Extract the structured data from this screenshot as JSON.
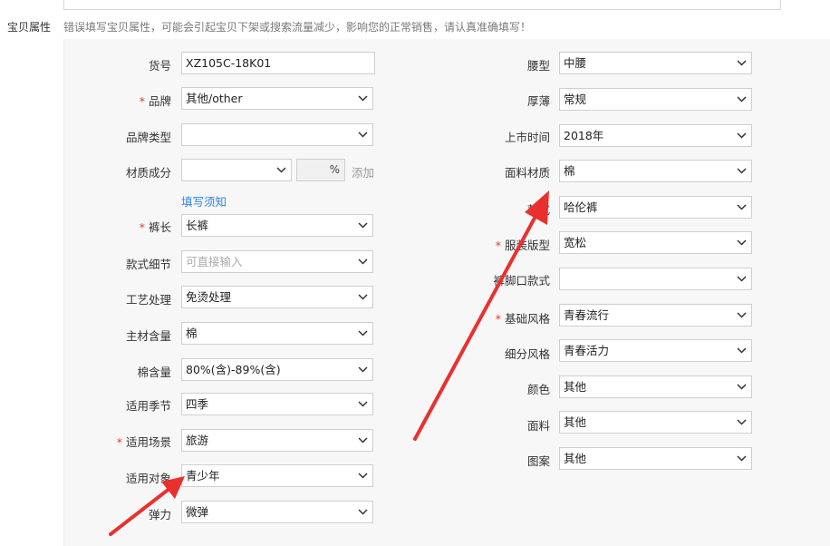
{
  "section": {
    "label": "宝贝属性",
    "note": "错误填写宝贝属性，可能会引起宝贝下架或搜索流量减少，影响您的正常销售，请认真准确填写！"
  },
  "left_fields": [
    {
      "label": "货号",
      "value": "XZ105C-18K01",
      "required": false
    },
    {
      "label": "品牌",
      "value": "其他/other",
      "required": true
    },
    {
      "label": "品牌类型",
      "value": "",
      "required": false
    },
    {
      "label": "材质成分",
      "value": "",
      "required": false
    },
    {
      "label": "裤长",
      "value": "长裤",
      "required": true
    },
    {
      "label": "款式细节",
      "value": "",
      "placeholder": "可直接输入",
      "required": false
    },
    {
      "label": "工艺处理",
      "value": "免烫处理",
      "required": false
    },
    {
      "label": "主材含量",
      "value": "棉",
      "required": false
    },
    {
      "label": "棉含量",
      "value": "80%(含)-89%(含)",
      "required": false
    },
    {
      "label": "适用季节",
      "value": "四季",
      "required": false
    },
    {
      "label": "适用场景",
      "value": "旅游",
      "required": true
    },
    {
      "label": "适用对象",
      "value": "青少年",
      "required": false
    },
    {
      "label": "弹力",
      "value": "微弹",
      "required": false
    }
  ],
  "material": {
    "percent_suffix": "%",
    "add_label": "添加",
    "help_link": "填写须知"
  },
  "right_fields": [
    {
      "label": "腰型",
      "value": "中腰",
      "required": false
    },
    {
      "label": "厚薄",
      "value": "常规",
      "required": false
    },
    {
      "label": "上市时间",
      "value": "2018年",
      "required": false
    },
    {
      "label": "面料材质",
      "value": "棉",
      "required": false
    },
    {
      "label": "款式",
      "value": "哈伦裤",
      "required": false
    },
    {
      "label": "服装版型",
      "value": "宽松",
      "required": true
    },
    {
      "label": "裤脚口款式",
      "value": "",
      "required": false
    },
    {
      "label": "基础风格",
      "value": "青春流行",
      "required": true
    },
    {
      "label": "细分风格",
      "value": "青春活力",
      "required": false
    },
    {
      "label": "颜色",
      "value": "其他",
      "required": false
    },
    {
      "label": "面料",
      "value": "其他",
      "required": false
    },
    {
      "label": "图案",
      "value": "其他",
      "required": false
    }
  ],
  "colors": {
    "required_star": "#e33333",
    "link": "#2e86de",
    "arrow": "#e8312f"
  }
}
